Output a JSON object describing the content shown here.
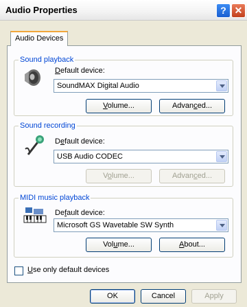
{
  "window": {
    "title": "Audio Properties",
    "help_glyph": "?",
    "close_glyph": "✕"
  },
  "tabs": [
    {
      "label": "Audio Devices"
    }
  ],
  "sound_playback": {
    "legend": "Sound playback",
    "default_label_u": "D",
    "default_label_rest": "efault device:",
    "device": "SoundMAX Digital Audio",
    "volume_u": "V",
    "volume_rest": "olume...",
    "advanced_pre": "Advan",
    "advanced_u": "c",
    "advanced_post": "ed...",
    "icon": "speaker-icon"
  },
  "sound_recording": {
    "legend": "Sound recording",
    "default_label_pre": "D",
    "default_label_u": "e",
    "default_label_post": "fault device:",
    "device": "USB Audio CODEC",
    "volume_pre": "V",
    "volume_u": "o",
    "volume_post": "lume...",
    "advanced_pre": "Advan",
    "advanced_u": "c",
    "advanced_post": "ed...",
    "icon": "microphone-icon"
  },
  "midi_playback": {
    "legend": "MIDI music playback",
    "default_label_pre": "De",
    "default_label_u": "f",
    "default_label_post": "ault device:",
    "device": "Microsoft GS Wavetable SW Synth",
    "volume_pre": "Vol",
    "volume_u": "u",
    "volume_post": "me...",
    "about_pre": "",
    "about_u": "A",
    "about_post": "bout...",
    "icon": "midi-keyboard-icon"
  },
  "use_only_default": {
    "u": "U",
    "rest": "se only default devices",
    "checked": false
  },
  "footer": {
    "ok": "OK",
    "cancel": "Cancel",
    "apply": "Apply"
  },
  "colors": {
    "legend_blue": "#0046d5",
    "tab_accent": "#f1a63a",
    "dialog_bg": "#ece9d8"
  }
}
